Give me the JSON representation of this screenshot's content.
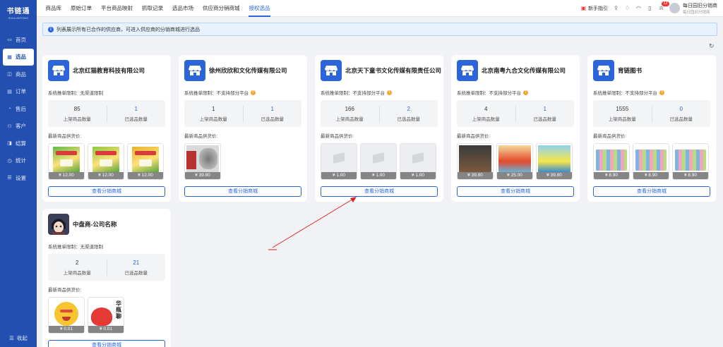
{
  "logo": {
    "name": "书链通",
    "sub": "SHULIANTONG"
  },
  "sidebar": {
    "items": [
      {
        "label": "首页",
        "icon": "monitor-icon"
      },
      {
        "label": "选品",
        "icon": "grid-icon",
        "active": true
      },
      {
        "label": "商品",
        "icon": "box-icon"
      },
      {
        "label": "订单",
        "icon": "document-icon"
      },
      {
        "label": "售后",
        "icon": "headset-icon"
      },
      {
        "label": "客户",
        "icon": "users-icon"
      },
      {
        "label": "结算",
        "icon": "wallet-icon"
      },
      {
        "label": "统计",
        "icon": "clock-icon"
      },
      {
        "label": "设置",
        "icon": "sliders-icon"
      }
    ],
    "collapse_label": "收起"
  },
  "tabs": [
    "商品库",
    "原始订单",
    "平台商品映射",
    "抓取记录",
    "选品市场",
    "供应商分销商城",
    "授权选品"
  ],
  "active_tab": 6,
  "topbar": {
    "guide_label": "新手指引",
    "notification_count": "12",
    "user_name": "每日园旧分销商",
    "user_sub": "每日园旧分销商"
  },
  "banner": {
    "text": "列表展示所有已合作的供应商，可进入供应商的分销商城进行选品"
  },
  "common": {
    "listed_label": "上架商品数量",
    "selected_label": "已选品数量",
    "prices_label": "最新商品供货价:",
    "view_button": "查看分销商城"
  },
  "suppliers": [
    {
      "name": "北京红猫教育科技有限公司",
      "limit": "系统推单限制：无渠道限制",
      "warn": false,
      "listed": "85",
      "selected": "1",
      "prices": [
        "¥ 12.00",
        "¥ 12.00",
        "¥ 12.00"
      ],
      "logo": "store-icon",
      "thumb_style": "green-book"
    },
    {
      "name": "徐州欣欣和文化传媒有限公司",
      "limit": "系统推单限制：不支持部分平台",
      "warn": true,
      "listed": "1",
      "selected": "1",
      "prices": [
        "¥ 39.80"
      ],
      "logo": "store-icon",
      "thumb_style": "wolf-book"
    },
    {
      "name": "北京天下童书文化传媒有限责任公司",
      "limit": "系统推单限制：不支持部分平台",
      "warn": true,
      "listed": "166",
      "selected": "2",
      "prices": [
        "¥ 1.00",
        "¥ 1.00",
        "¥ 1.00"
      ],
      "logo": "store-icon",
      "thumb_style": "placeholder"
    },
    {
      "name": "北京南粤九合文化传媒有限公司",
      "limit": "系统推单限制：不支持部分平台",
      "warn": true,
      "listed": "4",
      "selected": "1",
      "prices": [
        "¥ 39.80",
        "¥ 25.00",
        "¥ 39.80"
      ],
      "logo": "store-icon",
      "thumb_style": "mixed-book"
    },
    {
      "name": "育链图书",
      "limit": "系统推单限制：不支持部分平台",
      "warn": true,
      "listed": "1555",
      "selected": "0",
      "prices": [
        "¥ 8.90",
        "¥ 8.90",
        "¥ 8.90"
      ],
      "logo": "store-icon",
      "thumb_style": "set-book"
    },
    {
      "name": "中盘商-公司名称",
      "limit": "系统推单限制：无渠道限制",
      "warn": false,
      "listed": "2",
      "selected": "21",
      "prices": [
        "¥ 0.01",
        "¥ 0.01"
      ],
      "logo": "anime-avatar",
      "thumb_style": "emoji"
    }
  ],
  "colors": {
    "brand": "#2350b0",
    "accent": "#2b65d9",
    "warning": "#f3a72e",
    "badge": "#f23030",
    "arrow": "#e02020"
  }
}
